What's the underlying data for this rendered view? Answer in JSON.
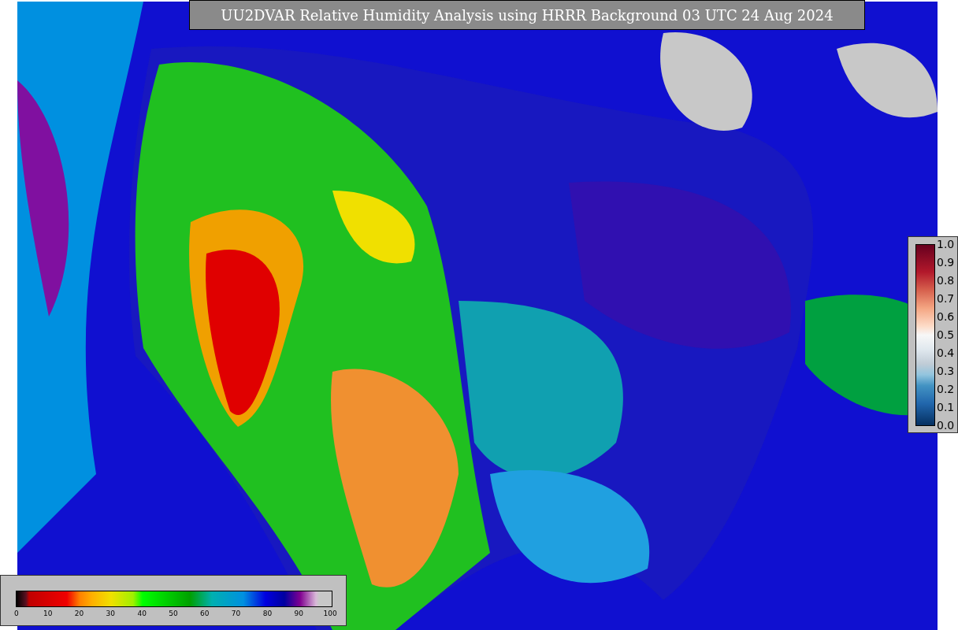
{
  "title": "UU2DVAR Relative Humidity Analysis using HRRR Background 03 UTC 24 Aug 2024",
  "bottom_colorbar": {
    "ticks": [
      "0",
      "10",
      "20",
      "30",
      "40",
      "50",
      "60",
      "70",
      "80",
      "90",
      "100"
    ]
  },
  "right_colorbar": {
    "ticks": [
      "1.0",
      "0.9",
      "0.8",
      "0.7",
      "0.6",
      "0.5",
      "0.4",
      "0.3",
      "0.2",
      "0.1",
      "0.0"
    ]
  }
}
